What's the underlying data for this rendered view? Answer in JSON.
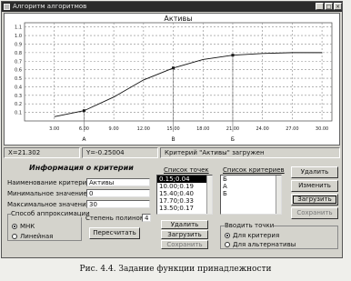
{
  "window": {
    "title": "Алгоритм алгоритмов",
    "buttons": {
      "min": "_",
      "max": "□",
      "close": "×"
    }
  },
  "chart_data": {
    "type": "line",
    "title": "Активы",
    "x_ticks": [
      "3.00",
      "6.00",
      "9.00",
      "12.00",
      "15.00",
      "18.00",
      "21.00",
      "24.00",
      "27.00",
      "30.00"
    ],
    "y_ticks": [
      "0.1",
      "0.2",
      "0.3",
      "0.4",
      "0.5",
      "0.6",
      "0.7",
      "0.8",
      "0.9",
      "1.0",
      "1.1"
    ],
    "xlim": [
      0,
      31
    ],
    "ylim": [
      0,
      1.15
    ],
    "grid": true,
    "series": [
      {
        "x": [
          3,
          6,
          9,
          12,
          15,
          18,
          21,
          24,
          27,
          30
        ],
        "y": [
          0.05,
          0.12,
          0.28,
          0.48,
          0.62,
          0.72,
          0.77,
          0.79,
          0.8,
          0.8
        ]
      }
    ],
    "points": [
      {
        "x": 6,
        "y": 0.12,
        "label": "A"
      },
      {
        "x": 15,
        "y": 0.62,
        "label": "B"
      },
      {
        "x": 21,
        "y": 0.77,
        "label": "Б"
      }
    ]
  },
  "statusbar": {
    "cell1": "X=21.302",
    "cell2": "Y=-0.25004",
    "cell3": "Критерий \"Активы\" загружен"
  },
  "info_panel": {
    "title": "Информация о критерии",
    "name_label": "Наименование критерия",
    "name_value": "Активы",
    "min_label": "Минимальное значение",
    "min_value": "0",
    "max_label": "Максимальное значение",
    "max_value": "30",
    "approx_group": "Способ аппроксимации",
    "radio_mnk": "МНК",
    "radio_linear": "Линейная",
    "degree_label": "Степень полинома",
    "degree_value": "4",
    "recalc_button": "Пересчитать"
  },
  "points_panel": {
    "title": "Список точек",
    "items": [
      "0.15;0.04",
      "10.00;0.19",
      "15.40;0.40",
      "17.70;0.33",
      "13.50;0.17"
    ],
    "delete_button": "Удалить",
    "load_button": "Загрузить",
    "save_button": "Сохранить"
  },
  "criteria_panel": {
    "title": "Список критериев",
    "items": [
      "Б",
      "А",
      "Б"
    ],
    "delete_button": "Удалить",
    "change_button": "Изменить",
    "load_button": "Загрузить",
    "save_button": "Сохранить",
    "enter_points_group": "Вводить точки",
    "radio_for_criterion": "Для критерия",
    "radio_for_alternative": "Для альтернативы"
  },
  "caption": "Рис. 4.4. Задание функции принадлежности"
}
